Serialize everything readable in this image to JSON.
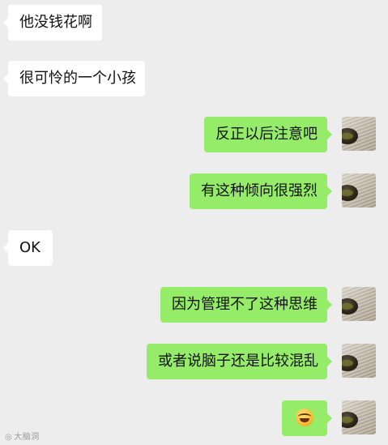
{
  "colors": {
    "background": "#ededed",
    "incoming_bubble": "#ffffff",
    "outgoing_bubble": "#95ec69",
    "text": "#111111"
  },
  "messages": [
    {
      "side": "incoming",
      "text": "他没钱花啊"
    },
    {
      "side": "incoming",
      "text": "很可怜的一个小孩"
    },
    {
      "side": "outgoing",
      "text": "反正以后注意吧"
    },
    {
      "side": "outgoing",
      "text": "有这种倾向很强烈"
    },
    {
      "side": "incoming",
      "text": "OK"
    },
    {
      "side": "outgoing",
      "text": "因为管理不了这种思维"
    },
    {
      "side": "outgoing",
      "text": "或者说脑子还是比较混乱"
    },
    {
      "side": "outgoing",
      "emoji": "laughing-crying-emoji"
    }
  ],
  "watermark": {
    "icon": "camera-icon",
    "text": "大脑洞"
  }
}
